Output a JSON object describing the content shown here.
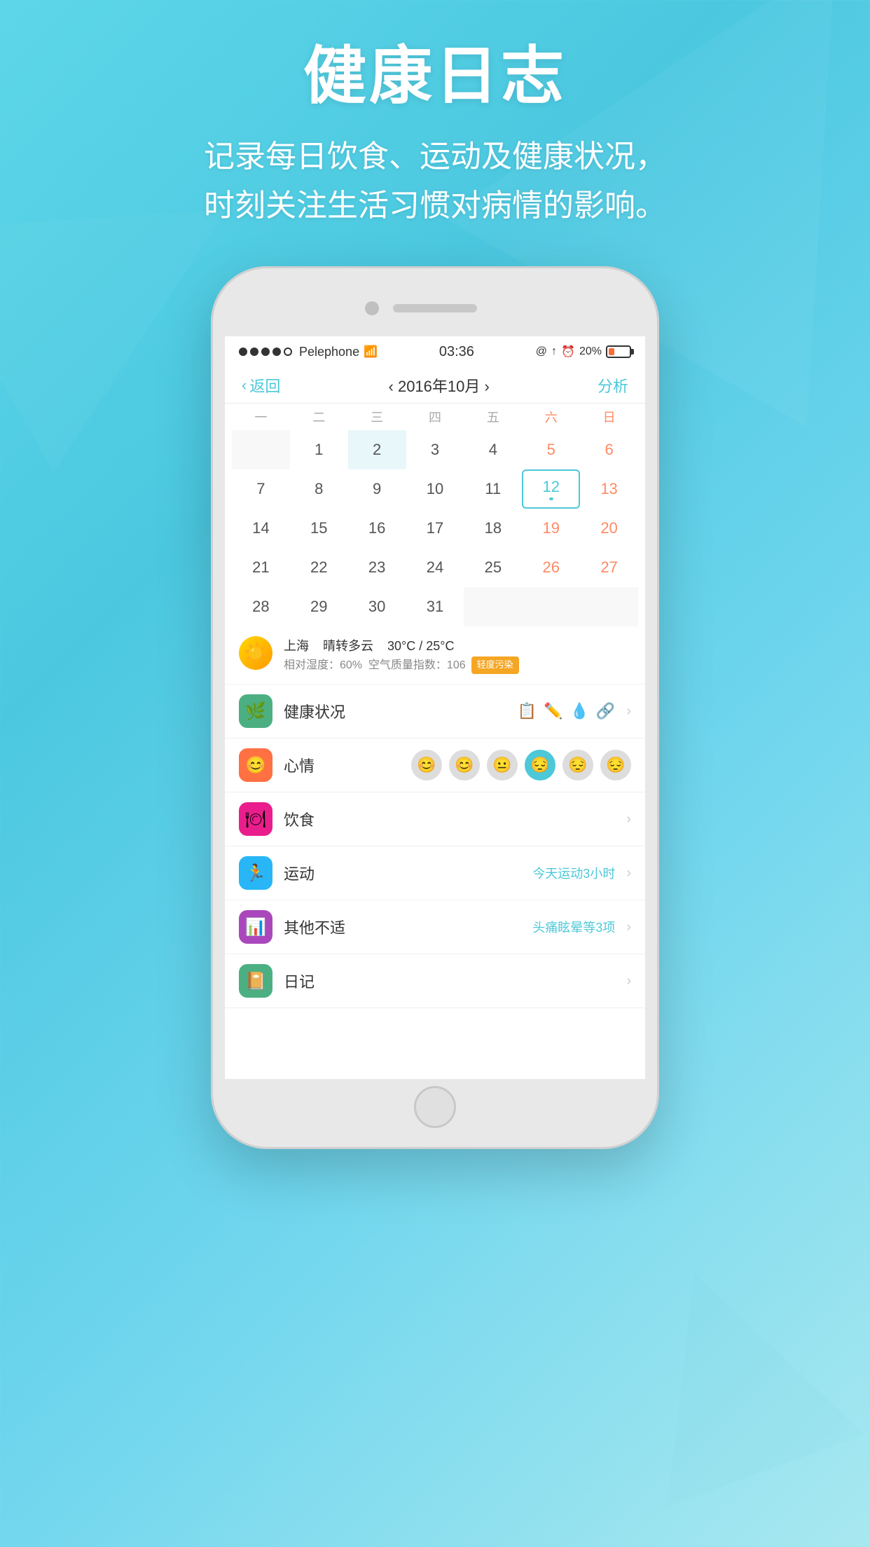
{
  "background": {
    "gradient_start": "#5dd6e8",
    "gradient_end": "#a8e8f0"
  },
  "header": {
    "title": "健康日志",
    "subtitle_line1": "记录每日饮食、运动及健康状况，",
    "subtitle_line2": "时刻关注生活习惯对病情的影响。"
  },
  "status_bar": {
    "dots": [
      "filled",
      "filled",
      "filled",
      "filled",
      "empty"
    ],
    "carrier": "Pelephone",
    "wifi": "WiFi",
    "time": "03:36",
    "icons": "@ ↑ ⏰",
    "battery": "20%"
  },
  "nav": {
    "back_label": "返回",
    "back_chevron": "‹",
    "title": "‹ 2016年10月 ›",
    "action": "分析"
  },
  "calendar": {
    "weekdays": [
      "一",
      "二",
      "三",
      "四",
      "五",
      "六",
      "日"
    ],
    "weeks": [
      [
        "",
        "1",
        "2",
        "3",
        "4",
        "5",
        "6"
      ],
      [
        "7",
        "8",
        "9",
        "10",
        "11",
        "12",
        "13"
      ],
      [
        "14",
        "15",
        "16",
        "17",
        "18",
        "19",
        "20"
      ],
      [
        "21",
        "22",
        "23",
        "24",
        "25",
        "26",
        "27"
      ],
      [
        "28",
        "29",
        "30",
        "31",
        "",
        "",
        ""
      ]
    ],
    "today": "12",
    "today_dot": true
  },
  "weather": {
    "city": "上海",
    "condition": "晴转多云",
    "temp_high": "30°C",
    "temp_low": "25°C",
    "humidity_label": "相对湿度：",
    "humidity": "60%",
    "air_label": "空气质量指数：",
    "air_index": "106",
    "pollution_badge": "轻度污染"
  },
  "list_items": [
    {
      "id": "health",
      "icon_color": "green",
      "icon": "🌿",
      "label": "健康状况",
      "has_health_icons": true,
      "health_icons": [
        "📋",
        "✏️",
        "💧",
        "🔗"
      ],
      "chevron": "›"
    },
    {
      "id": "mood",
      "icon_color": "orange",
      "icon": "😊",
      "label": "心情",
      "mood_faces": [
        "😊",
        "😊",
        "😐",
        "😔",
        "😔",
        "😔"
      ],
      "active_mood": 3,
      "chevron": ""
    },
    {
      "id": "diet",
      "icon_color": "pink",
      "icon": "🍽",
      "label": "饮食",
      "value": "",
      "chevron": "›"
    },
    {
      "id": "exercise",
      "icon_color": "blue",
      "icon": "🏃",
      "label": "运动",
      "value": "今天运动3小时",
      "chevron": "›"
    },
    {
      "id": "discomfort",
      "icon_color": "purple",
      "icon": "📊",
      "label": "其他不适",
      "value": "头痛眩晕等3项",
      "chevron": "›"
    },
    {
      "id": "diary",
      "icon_color": "green",
      "icon": "📔",
      "label": "日记",
      "value": "",
      "chevron": "›"
    }
  ]
}
